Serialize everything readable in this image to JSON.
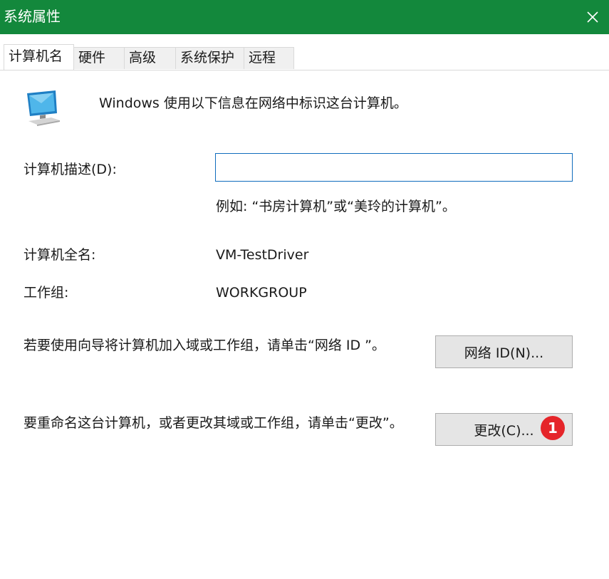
{
  "window": {
    "title": "系统属性",
    "close_icon": "close-icon"
  },
  "tabs": [
    {
      "label": "计算机名",
      "active": true
    },
    {
      "label": "硬件"
    },
    {
      "label": "高级"
    },
    {
      "label": "系统保护"
    },
    {
      "label": "远程"
    }
  ],
  "intro": {
    "icon": "computer-icon",
    "text": "Windows 使用以下信息在网络中标识这台计算机。"
  },
  "description": {
    "label": "计算机描述(D):",
    "value": "",
    "placeholder": "",
    "example": "例如: “书房计算机”或“美玲的计算机”。"
  },
  "full_name": {
    "label": "计算机全名:",
    "value": "VM-TestDriver"
  },
  "workgroup": {
    "label": "工作组:",
    "value": "WORKGROUP"
  },
  "network_id": {
    "text": "若要使用向导将计算机加入域或工作组，请单击“网络 ID ”。",
    "button_label": "网络 ID(N)..."
  },
  "change": {
    "text": "要重命名这台计算机，或者更改其域或工作组，请单击“更改”。",
    "button_label": "更改(C)...",
    "badge": "1",
    "badge_color": "#e5252a"
  },
  "colors": {
    "titlebar": "#13883c",
    "input_border": "#0f6cbd"
  }
}
